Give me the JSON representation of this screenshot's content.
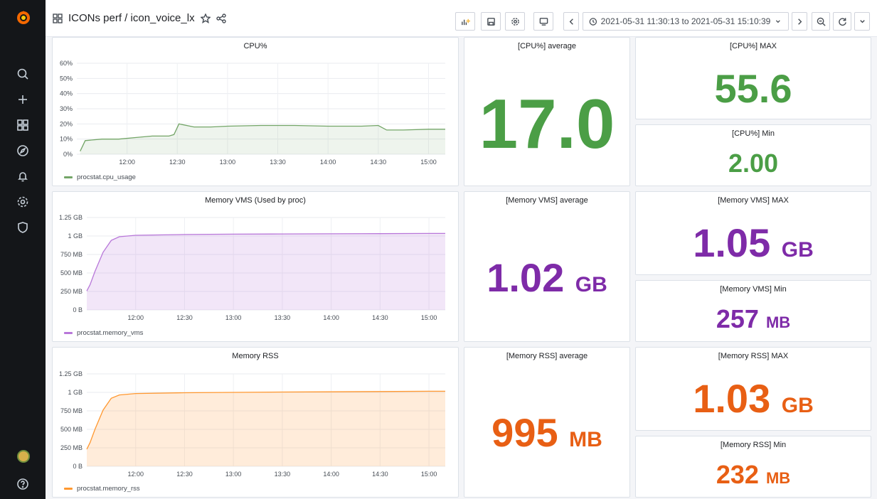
{
  "header": {
    "breadcrumb": "ICONs perf / icon_voice_lx",
    "time_range": "2021-05-31 11:30:13 to 2021-05-31 15:10:39"
  },
  "sidebar": {
    "items": [
      {
        "icon": "search-icon"
      },
      {
        "icon": "plus-icon"
      },
      {
        "icon": "dashboards-icon"
      },
      {
        "icon": "explore-icon"
      },
      {
        "icon": "bell-icon"
      },
      {
        "icon": "gear-icon"
      },
      {
        "icon": "shield-icon"
      }
    ],
    "help_icon": "help-icon"
  },
  "panels": {
    "cpu_graph": {
      "title": "CPU%",
      "legend": "procstat.cpu_usage"
    },
    "cpu_avg": {
      "title": "[CPU%] average",
      "value": "17.0",
      "unit": ""
    },
    "cpu_max": {
      "title": "[CPU%] MAX",
      "value": "55.6",
      "unit": ""
    },
    "cpu_min": {
      "title": "[CPU%] Min",
      "value": "2.00",
      "unit": ""
    },
    "vms_graph": {
      "title": "Memory VMS (Used by proc)",
      "legend": "procstat.memory_vms"
    },
    "vms_avg": {
      "title": "[Memory VMS] average",
      "value": "1.02",
      "unit": "GB"
    },
    "vms_max": {
      "title": "[Memory VMS] MAX",
      "value": "1.05",
      "unit": "GB"
    },
    "vms_min": {
      "title": "[Memory VMS] Min",
      "value": "257",
      "unit": "MB"
    },
    "rss_graph": {
      "title": "Memory RSS",
      "legend": "procstat.memory_rss"
    },
    "rss_avg": {
      "title": "[Memory RSS] average",
      "value": "995",
      "unit": "MB"
    },
    "rss_max": {
      "title": "[Memory RSS] MAX",
      "value": "1.03",
      "unit": "GB"
    },
    "rss_min": {
      "title": "[Memory RSS] Min",
      "value": "232",
      "unit": "MB"
    }
  },
  "colors": {
    "green": "#4b9e46",
    "purple": "#7e2ba8",
    "orange": "#e85f14",
    "cpu_line": "#73a567",
    "vms_line": "#b877d9",
    "rss_line": "#ff9830"
  },
  "chart_data": [
    {
      "type": "line",
      "title": "CPU%",
      "x": [
        "11:32",
        "11:35",
        "11:45",
        "11:55",
        "12:05",
        "12:15",
        "12:25",
        "12:28",
        "12:31",
        "12:40",
        "12:50",
        "13:00",
        "13:20",
        "13:40",
        "14:00",
        "14:20",
        "14:30",
        "14:35",
        "14:45",
        "15:00",
        "15:10"
      ],
      "x_ticks": [
        "12:00",
        "12:30",
        "13:00",
        "13:30",
        "14:00",
        "14:30",
        "15:00"
      ],
      "y_ticks": [
        "0%",
        "10%",
        "20%",
        "30%",
        "40%",
        "50%",
        "60%"
      ],
      "ylim": [
        0,
        60
      ],
      "series": [
        {
          "name": "procstat.cpu_usage",
          "values": [
            2,
            9,
            10,
            10,
            11,
            12,
            12,
            13,
            20,
            18,
            18,
            18.5,
            19,
            19,
            18.5,
            18.5,
            19,
            16,
            16,
            16.5,
            16.5
          ]
        }
      ]
    },
    {
      "type": "area",
      "title": "Memory VMS (Used by proc)",
      "x": [
        "11:30",
        "11:32",
        "11:35",
        "11:40",
        "11:45",
        "11:50",
        "12:00",
        "12:30",
        "13:00",
        "13:30",
        "14:00",
        "14:30",
        "15:00",
        "15:10"
      ],
      "x_ticks": [
        "12:00",
        "12:30",
        "13:00",
        "13:30",
        "14:00",
        "14:30",
        "15:00"
      ],
      "y_ticks": [
        "0 B",
        "250 MB",
        "500 MB",
        "750 MB",
        "1 GB",
        "1.25 GB"
      ],
      "ylim": [
        0,
        1250
      ],
      "y_unit": "MB",
      "series": [
        {
          "name": "procstat.memory_vms",
          "values": [
            257,
            340,
            520,
            780,
            940,
            990,
            1010,
            1020,
            1025,
            1028,
            1030,
            1032,
            1035,
            1035
          ]
        }
      ]
    },
    {
      "type": "area",
      "title": "Memory RSS",
      "x": [
        "11:30",
        "11:32",
        "11:35",
        "11:40",
        "11:45",
        "11:50",
        "12:00",
        "12:30",
        "13:00",
        "13:30",
        "14:00",
        "14:30",
        "15:00",
        "15:10"
      ],
      "x_ticks": [
        "12:00",
        "12:30",
        "13:00",
        "13:30",
        "14:00",
        "14:30",
        "15:00"
      ],
      "y_ticks": [
        "0 B",
        "250 MB",
        "500 MB",
        "750 MB",
        "1 GB",
        "1.25 GB"
      ],
      "ylim": [
        0,
        1250
      ],
      "y_unit": "MB",
      "series": [
        {
          "name": "procstat.memory_rss",
          "values": [
            232,
            320,
            500,
            760,
            920,
            965,
            985,
            995,
            1000,
            1005,
            1008,
            1012,
            1015,
            1015
          ]
        }
      ]
    }
  ]
}
